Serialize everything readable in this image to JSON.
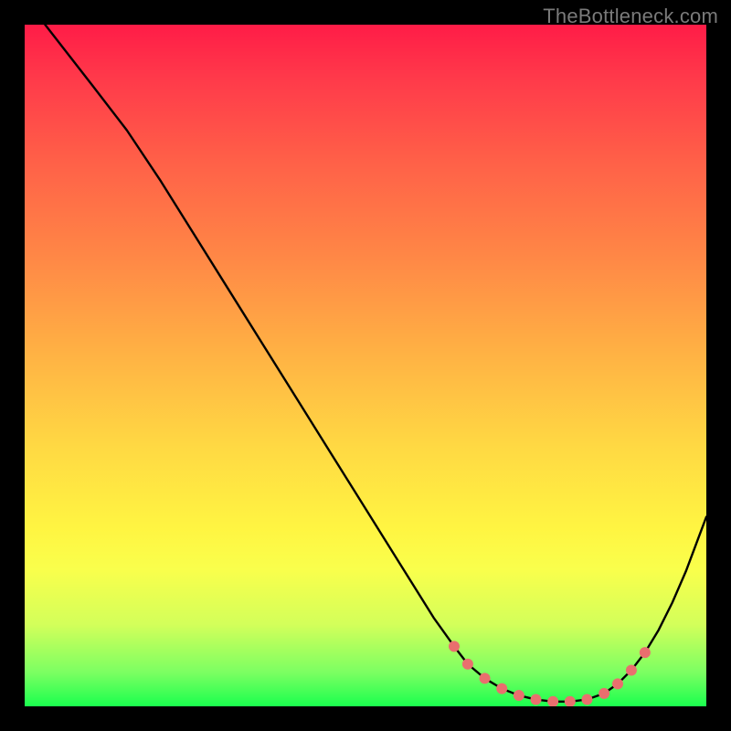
{
  "watermark": "TheBottleneck.com",
  "chart_data": {
    "type": "line",
    "title": "",
    "xlabel": "",
    "ylabel": "",
    "xlim": [
      0,
      100
    ],
    "ylim": [
      0,
      100
    ],
    "series": [
      {
        "name": "curve",
        "x": [
          3,
          10,
          15,
          20,
          25,
          30,
          35,
          40,
          45,
          50,
          55,
          60,
          63,
          65,
          67.5,
          70,
          72.5,
          75,
          77.5,
          80,
          82.5,
          85,
          87,
          89,
          91,
          93,
          95,
          97,
          100
        ],
        "y": [
          100,
          91,
          84.5,
          77,
          69,
          61,
          53,
          45,
          37,
          29,
          21,
          13,
          8.8,
          6.2,
          4.1,
          2.6,
          1.6,
          1.0,
          0.7,
          0.7,
          1.0,
          1.9,
          3.3,
          5.3,
          7.9,
          11.2,
          15.2,
          19.8,
          27.8
        ]
      }
    ],
    "markers": {
      "name": "dots",
      "color": "#e96f6e",
      "points": [
        {
          "x": 63.0,
          "y": 8.8
        },
        {
          "x": 65.0,
          "y": 6.2
        },
        {
          "x": 67.5,
          "y": 4.1
        },
        {
          "x": 70.0,
          "y": 2.6
        },
        {
          "x": 72.5,
          "y": 1.6
        },
        {
          "x": 75.0,
          "y": 1.0
        },
        {
          "x": 77.5,
          "y": 0.7
        },
        {
          "x": 80.0,
          "y": 0.7
        },
        {
          "x": 82.5,
          "y": 1.0
        },
        {
          "x": 85.0,
          "y": 1.9
        },
        {
          "x": 87.0,
          "y": 3.3
        },
        {
          "x": 89.0,
          "y": 5.3
        },
        {
          "x": 91.0,
          "y": 7.9
        }
      ]
    }
  }
}
